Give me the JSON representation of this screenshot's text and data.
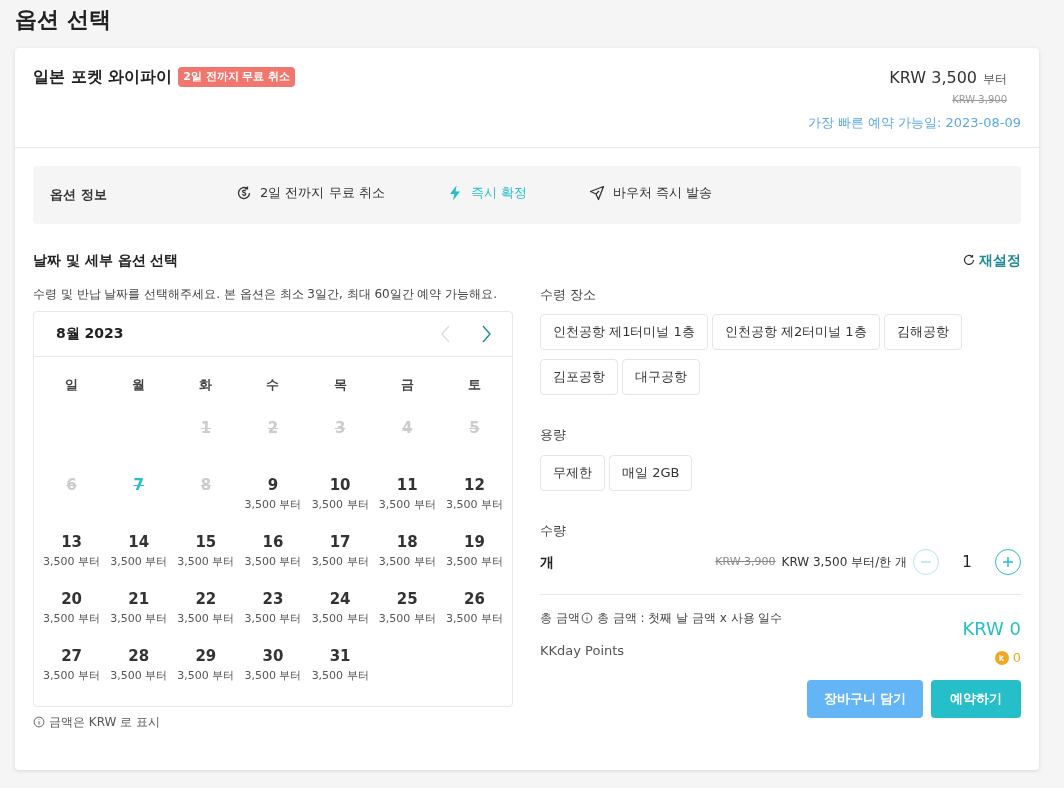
{
  "page_title": "옵션 선택",
  "product": {
    "name": "일본 포켓 와이파이",
    "badge": "2일 전까지 무료 취소",
    "price": "KRW 3,500",
    "price_suffix": "부터",
    "original_price": "KRW 3,900",
    "earliest": "가장 빠른 예약 가능일: 2023-08-09"
  },
  "option_info": {
    "label": "옵션 정보",
    "items": [
      {
        "kind": "cancel",
        "text": "2일 전까지 무료 취소"
      },
      {
        "kind": "instant",
        "text": "즉시 확정"
      },
      {
        "kind": "voucher",
        "text": "바우처 즉시 발송"
      }
    ]
  },
  "section_title": "날짜 및 세부 옵션 선택",
  "reset": "재설정",
  "instruction": "수령 및 반납 날짜를 선택해주세요. 본 옵션은 최소 3일간, 최대 60일간 예약 가능해요.",
  "calendar": {
    "month": "8월 2023",
    "weekdays": [
      "일",
      "월",
      "화",
      "수",
      "목",
      "금",
      "토"
    ],
    "weeks": [
      [
        {
          "kind": "empty"
        },
        {
          "kind": "empty"
        },
        {
          "kind": "disabled",
          "day": "1"
        },
        {
          "kind": "disabled",
          "day": "2"
        },
        {
          "kind": "disabled",
          "day": "3"
        },
        {
          "kind": "disabled",
          "day": "4"
        },
        {
          "kind": "disabled",
          "day": "5"
        }
      ],
      [
        {
          "kind": "disabled",
          "day": "6"
        },
        {
          "kind": "today",
          "day": "7"
        },
        {
          "kind": "disabled",
          "day": "8"
        },
        {
          "kind": "available",
          "day": "9",
          "price": "3,500 부터"
        },
        {
          "kind": "available",
          "day": "10",
          "price": "3,500 부터"
        },
        {
          "kind": "available",
          "day": "11",
          "price": "3,500 부터"
        },
        {
          "kind": "available",
          "day": "12",
          "price": "3,500 부터"
        }
      ],
      [
        {
          "kind": "available",
          "day": "13",
          "price": "3,500 부터"
        },
        {
          "kind": "available",
          "day": "14",
          "price": "3,500 부터"
        },
        {
          "kind": "available",
          "day": "15",
          "price": "3,500 부터"
        },
        {
          "kind": "available",
          "day": "16",
          "price": "3,500 부터"
        },
        {
          "kind": "available",
          "day": "17",
          "price": "3,500 부터"
        },
        {
          "kind": "available",
          "day": "18",
          "price": "3,500 부터"
        },
        {
          "kind": "available",
          "day": "19",
          "price": "3,500 부터"
        }
      ],
      [
        {
          "kind": "available",
          "day": "20",
          "price": "3,500 부터"
        },
        {
          "kind": "available",
          "day": "21",
          "price": "3,500 부터"
        },
        {
          "kind": "available",
          "day": "22",
          "price": "3,500 부터"
        },
        {
          "kind": "available",
          "day": "23",
          "price": "3,500 부터"
        },
        {
          "kind": "available",
          "day": "24",
          "price": "3,500 부터"
        },
        {
          "kind": "available",
          "day": "25",
          "price": "3,500 부터"
        },
        {
          "kind": "available",
          "day": "26",
          "price": "3,500 부터"
        }
      ],
      [
        {
          "kind": "available",
          "day": "27",
          "price": "3,500 부터"
        },
        {
          "kind": "available",
          "day": "28",
          "price": "3,500 부터"
        },
        {
          "kind": "available",
          "day": "29",
          "price": "3,500 부터"
        },
        {
          "kind": "available",
          "day": "30",
          "price": "3,500 부터"
        },
        {
          "kind": "available",
          "day": "31",
          "price": "3,500 부터"
        }
      ]
    ],
    "prev_disabled": true,
    "note": "금액은 KRW 로 표시"
  },
  "pickup": {
    "label": "수령 장소",
    "options": [
      {
        "label": "인천공항 제1터미널 1층",
        "selected": false
      },
      {
        "label": "인천공항 제2터미널 1층",
        "selected": false
      },
      {
        "label": "김해공항",
        "selected": false
      },
      {
        "label": "김포공항",
        "selected": false
      },
      {
        "label": "대구공항",
        "selected": false
      }
    ]
  },
  "capacity": {
    "label": "용량",
    "options": [
      {
        "label": "무제한",
        "selected": false
      },
      {
        "label": "매일 2GB",
        "selected": false
      }
    ]
  },
  "quantity": {
    "label": "수량",
    "unit": "개",
    "original_price": "KRW 3,900",
    "price": "KRW 3,500 부터/한 개",
    "value": "1",
    "minus_disabled": true
  },
  "total": {
    "label": "총 금액",
    "note": "총 금액 : 첫째 날 금액 x 사용 일수",
    "amount": "KRW 0"
  },
  "points": {
    "label": "KKday Points",
    "value": "0"
  },
  "buttons": [
    {
      "kind": "cart",
      "label": "장바구니 담기"
    },
    {
      "kind": "book",
      "label": "예약하기"
    }
  ]
}
